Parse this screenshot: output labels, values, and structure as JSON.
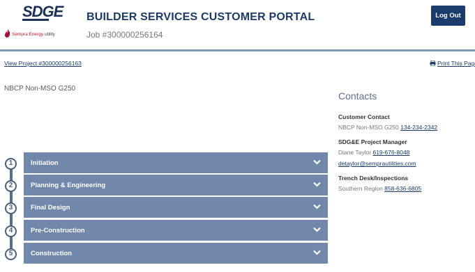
{
  "header": {
    "logo_text": "SDGE",
    "logo_subtext": "Sempra Energy",
    "logo_subtext_suffix": "utility",
    "portal_title": "BUILDER SERVICES CUSTOMER PORTAL",
    "job_number": "Job #300000256164",
    "logout_label": "Log Out"
  },
  "links": {
    "view_project": "View Project #300000256163",
    "print_page": "Print This Page"
  },
  "project_name": "NBCP Non-MSO G250",
  "steps": [
    {
      "number": "1",
      "label": "Initiation"
    },
    {
      "number": "2",
      "label": "Planning & Engineering"
    },
    {
      "number": "3",
      "label": "Final Design"
    },
    {
      "number": "4",
      "label": "Pre-Construction"
    },
    {
      "number": "5",
      "label": "Construction"
    }
  ],
  "contacts": {
    "title": "Contacts",
    "customer_contact": {
      "heading": "Customer Contact",
      "name": "NBCP Non-MSO G250",
      "phone": "134-234-2342"
    },
    "project_manager": {
      "heading": "SDG&E Project Manager",
      "name": "Diane Taylor",
      "phone": "619-676-8048",
      "email": "detaylor@semprautilities.com"
    },
    "trench_desk": {
      "heading": "Trench Desk/Inspections",
      "name": "Southern Region",
      "phone": "858-636-6805"
    }
  },
  "colors": {
    "brand_navy": "#1d3c6e",
    "step_bar": "#7288ab",
    "header_rule": "#7d95b8"
  }
}
